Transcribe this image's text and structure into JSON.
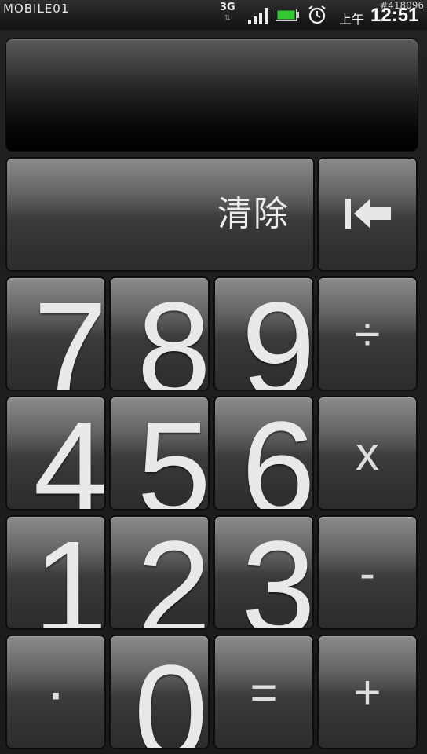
{
  "status_bar": {
    "carrier_logo": "MOBILE01",
    "watermark": "#418096",
    "network_type": "3G",
    "data_arrows": "⇅",
    "ampm": "上午",
    "time": "12:51",
    "battery_color": "#34c934",
    "icons": [
      "signal-icon",
      "battery-icon",
      "alarm-icon"
    ]
  },
  "display": {
    "value": ""
  },
  "keys": {
    "clear": "清除",
    "backspace_icon": "backspace-icon",
    "digits": {
      "0": "0",
      "1": "1",
      "2": "2",
      "3": "3",
      "4": "4",
      "5": "5",
      "6": "6",
      "7": "7",
      "8": "8",
      "9": "9"
    },
    "decimal": "·",
    "divide": "÷",
    "multiply": "x",
    "subtract": "-",
    "add": "+",
    "equals": "="
  }
}
